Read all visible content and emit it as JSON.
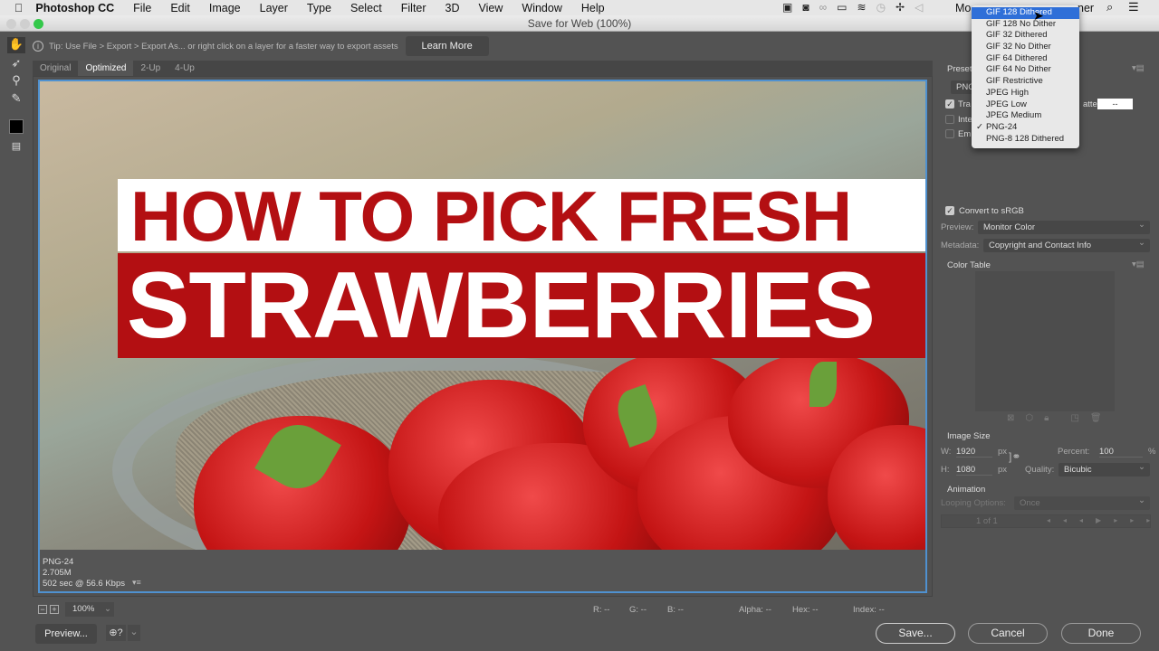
{
  "menubar": {
    "app": "Photoshop CC",
    "items": [
      "File",
      "Edit",
      "Image",
      "Layer",
      "Type",
      "Select",
      "Filter",
      "3D",
      "View",
      "Window",
      "Help"
    ],
    "right_text_left": "Mo",
    "right_text_right": "ner"
  },
  "window": {
    "title": "Save for Web (100%)"
  },
  "tip": {
    "text": "Tip: Use File > Export > Export As...  or right click on a layer for a faster way to export assets",
    "learn_more": "Learn More"
  },
  "tabs": [
    {
      "label": "Original",
      "active": false
    },
    {
      "label": "Optimized",
      "active": true
    },
    {
      "label": "2-Up",
      "active": false
    },
    {
      "label": "4-Up",
      "active": false
    }
  ],
  "image": {
    "line1": "HOW TO PICK FRESH",
    "line2": "STRAWBERRIES"
  },
  "image_info": {
    "format": "PNG-24",
    "size": "2.705M",
    "time": "502 sec @ 56.6 Kbps"
  },
  "zoom": {
    "value": "100%"
  },
  "readouts": {
    "r": "R: --",
    "g": "G: --",
    "b": "B: --",
    "alpha": "Alpha: --",
    "hex": "Hex: --",
    "index": "Index: --"
  },
  "buttons": {
    "preview": "Preview...",
    "save": "Save...",
    "cancel": "Cancel",
    "done": "Done"
  },
  "settings": {
    "preset_label": "Preset",
    "format_value": "PNG",
    "transparency": "Tra",
    "interlaced": "Inte",
    "embed": "Em",
    "matte_label": "atte:",
    "matte_value": "--",
    "convert_srgb": "Convert to sRGB",
    "convert_checked": true,
    "preview_label": "Preview:",
    "preview_value": "Monitor Color",
    "metadata_label": "Metadata:",
    "metadata_value": "Copyright and Contact Info",
    "color_table": "Color Table",
    "image_size": "Image Size",
    "w_label": "W:",
    "w_value": "1920",
    "h_label": "H:",
    "h_value": "1080",
    "px": "px",
    "percent_label": "Percent:",
    "percent_value": "100",
    "percent_unit": "%",
    "quality_label": "Quality:",
    "quality_value": "Bicubic",
    "animation": "Animation",
    "looping_label": "Looping Options:",
    "looping_value": "Once",
    "frame_counter": "1 of 1"
  },
  "dropdown": {
    "options": [
      "GIF 128 Dithered",
      "GIF 128 No Dither",
      "GIF 32 Dithered",
      "GIF 32 No Dither",
      "GIF 64 Dithered",
      "GIF 64 No Dither",
      "GIF Restrictive",
      "JPEG High",
      "JPEG Low",
      "JPEG Medium",
      "PNG-24",
      "PNG-8 128 Dithered"
    ],
    "highlighted": "GIF 128 Dithered",
    "checked": "PNG-24"
  },
  "colors": {
    "accent": "#4f91d0",
    "banner_red": "#b30f12",
    "highlight": "#2f6fd8"
  }
}
